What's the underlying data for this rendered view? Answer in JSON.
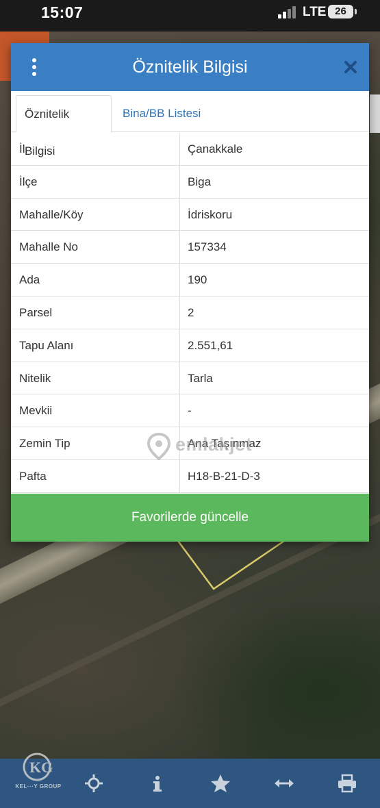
{
  "status_bar": {
    "time": "15:07",
    "network": "LTE",
    "battery": "26"
  },
  "dialog": {
    "title": "Öznitelik Bilgisi",
    "tabs": [
      {
        "label": "Öznitelik Bilgisi",
        "active": true
      },
      {
        "label": "Bina/BB Listesi",
        "active": false
      }
    ],
    "rows": [
      {
        "label": "İl",
        "value": "Çanakkale"
      },
      {
        "label": "İlçe",
        "value": "Biga"
      },
      {
        "label": "Mahalle/Köy",
        "value": "İdriskoru"
      },
      {
        "label": "Mahalle No",
        "value": "157334"
      },
      {
        "label": "Ada",
        "value": "190"
      },
      {
        "label": "Parsel",
        "value": "2"
      },
      {
        "label": "Tapu Alanı",
        "value": "2.551,61"
      },
      {
        "label": "Nitelik",
        "value": "Tarla"
      },
      {
        "label": "Mevkii",
        "value": "-"
      },
      {
        "label": "Zemin Tip",
        "value": "Ana Taşınmaz"
      },
      {
        "label": "Pafta",
        "value": "H18-B-21-D-3"
      }
    ],
    "favorite_button": "Favorilerde güncelle"
  },
  "watermark": "emlakjet",
  "bottom_bar": {
    "tools": [
      "locate-icon",
      "info-icon",
      "star-icon",
      "measure-icon",
      "print-icon"
    ]
  },
  "colors": {
    "header": "#3a7ec3",
    "button": "#5cb85c",
    "toolbar": "#2e5680",
    "tab_link": "#2f74b8"
  }
}
